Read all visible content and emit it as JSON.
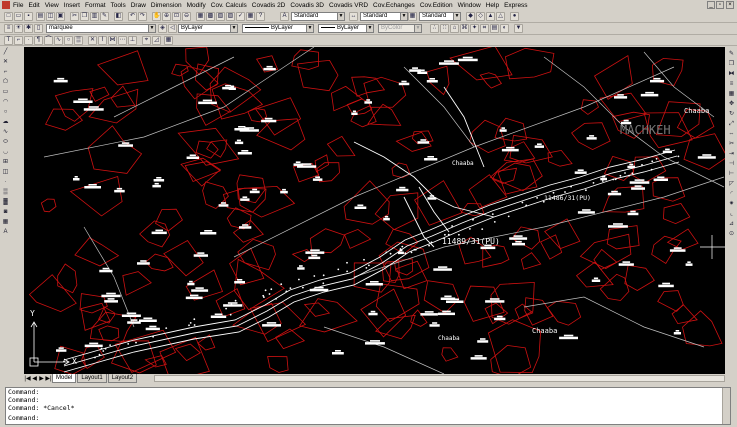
{
  "menu": {
    "items": [
      "File",
      "Edit",
      "View",
      "Insert",
      "Format",
      "Tools",
      "Draw",
      "Dimension",
      "Modify",
      "Cov. Calculs",
      "Covadis 2D",
      "Covadis 3D",
      "Covadis VRD",
      "Cov.Echanges",
      "Cov.Edition",
      "Window",
      "Help",
      "Express"
    ]
  },
  "toolbar": {
    "text_style": "Standard",
    "dim_style": "Standard",
    "table_style": "Standard",
    "layer_name": "marquee",
    "color": "ByLayer",
    "linetype": "ByLayer",
    "lineweight": "ByLayer",
    "plot_style": "ByColor"
  },
  "drawing": {
    "labels": {
      "chaaba_top_right": "Chaaba",
      "chaaba_center": "Chaaba",
      "chaaba_bottom": "Chaaba",
      "chaaba_bottom_left": "Chaaba",
      "place_name": "MACHKEH",
      "parcel_1": "11486/31(PU)",
      "parcel_2": "11489/31(PU)",
      "ucs_y": "Y",
      "ucs_x": "X"
    },
    "colors": {
      "background": "#000000",
      "parcels": "#cc1111",
      "roads": "#ffffff",
      "lines": "#bfbfbf"
    }
  },
  "tabs": {
    "model": "Model",
    "layout1": "Layout1",
    "layout2": "Layout2"
  },
  "command": {
    "lines": [
      "Command:",
      "Command:",
      "Command: *Cancel*"
    ],
    "prompt": "Command:"
  }
}
